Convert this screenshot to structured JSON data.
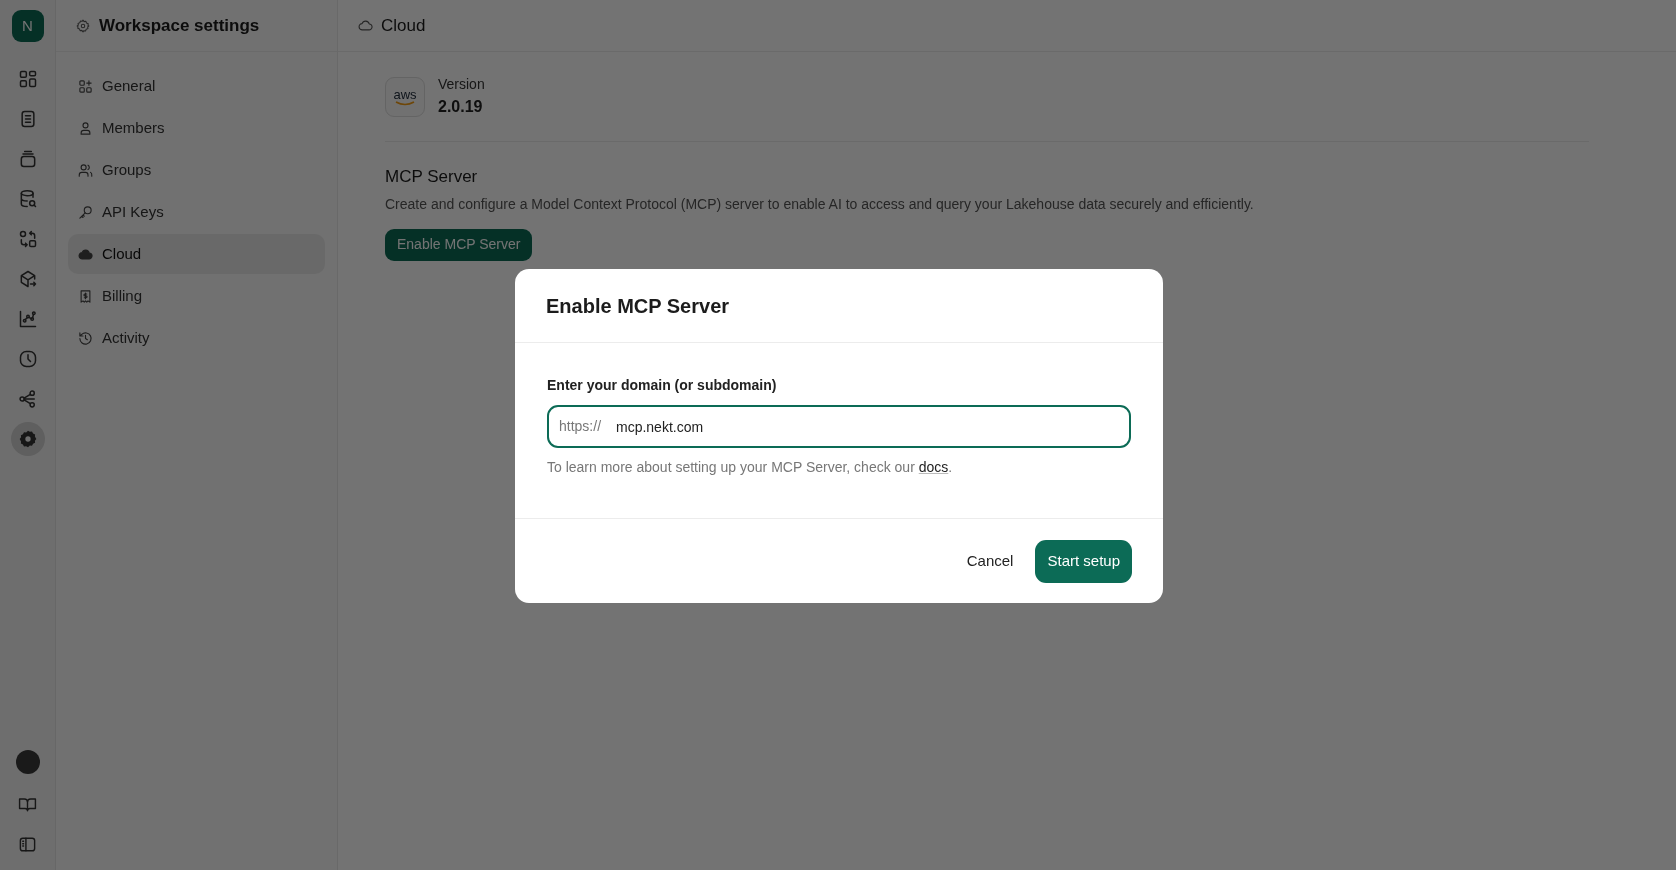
{
  "workspace": {
    "initial": "N"
  },
  "rail": {
    "items": [
      {
        "selected": false
      },
      {
        "selected": false
      },
      {
        "selected": false
      },
      {
        "selected": false
      },
      {
        "selected": false
      },
      {
        "selected": false
      },
      {
        "selected": false
      },
      {
        "selected": false
      },
      {
        "selected": false
      },
      {
        "selected": true
      }
    ]
  },
  "sidebar": {
    "title": "Workspace settings",
    "items": [
      {
        "label": "General",
        "selected": false
      },
      {
        "label": "Members",
        "selected": false
      },
      {
        "label": "Groups",
        "selected": false
      },
      {
        "label": "API Keys",
        "selected": false
      },
      {
        "label": "Cloud",
        "selected": true
      },
      {
        "label": "Billing",
        "selected": false
      },
      {
        "label": "Activity",
        "selected": false
      }
    ]
  },
  "header": {
    "title": "Cloud"
  },
  "version": {
    "logo": "aws",
    "label": "Version",
    "value": "2.0.19"
  },
  "mcp": {
    "title": "MCP Server",
    "description": "Create and configure a Model Context Protocol (MCP) server to enable AI to access and query your Lakehouse data securely and efficiently.",
    "button": "Enable MCP Server"
  },
  "dialog": {
    "title": "Enable MCP Server",
    "field_label": "Enter your domain (or subdomain)",
    "prefix": "https://",
    "value": "mcp.nekt.com",
    "hint_before": "To learn more about setting up your MCP Server, check our ",
    "hint_link": "docs",
    "hint_after": ".",
    "cancel": "Cancel",
    "confirm": "Start setup"
  }
}
